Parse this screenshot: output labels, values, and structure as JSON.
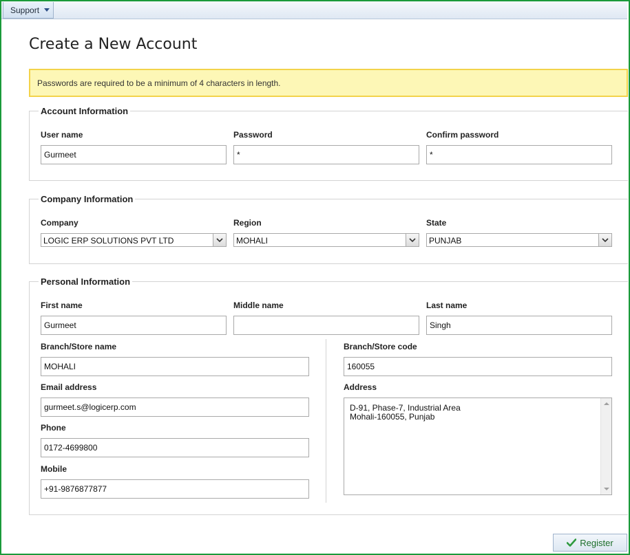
{
  "menu": {
    "support": "Support"
  },
  "page": {
    "title": "Create a New Account",
    "alert": "Passwords are required to be a minimum of 4 characters in length."
  },
  "account": {
    "legend": "Account Information",
    "username_label": "User name",
    "username_value": "Gurmeet",
    "password_label": "Password",
    "password_value": "*",
    "confirm_label": "Confirm password",
    "confirm_value": "*"
  },
  "company": {
    "legend": "Company Information",
    "company_label": "Company",
    "company_value": "LOGIC ERP SOLUTIONS PVT LTD",
    "region_label": "Region",
    "region_value": "MOHALI",
    "state_label": "State",
    "state_value": "PUNJAB"
  },
  "personal": {
    "legend": "Personal Information",
    "first_label": "First name",
    "first_value": "Gurmeet",
    "middle_label": "Middle name",
    "middle_value": "",
    "last_label": "Last name",
    "last_value": "Singh",
    "branch_name_label": "Branch/Store name",
    "branch_name_value": "MOHALI",
    "branch_code_label": "Branch/Store code",
    "branch_code_value": "160055",
    "email_label": "Email address",
    "email_value": "gurmeet.s@logicerp.com",
    "address_label": "Address",
    "address_lines": [
      "D-91, Phase-7, Industrial Area",
      "Mohali-160055, Punjab"
    ],
    "phone_label": "Phone",
    "phone_value": "0172-4699800",
    "mobile_label": "Mobile",
    "mobile_value": "+91-9876877877"
  },
  "actions": {
    "register": "Register"
  },
  "colors": {
    "frame": "#1a9a3a",
    "alert_bg": "#fdf7b6",
    "alert_border": "#f3d34a",
    "register_text": "#1c6e2a"
  }
}
